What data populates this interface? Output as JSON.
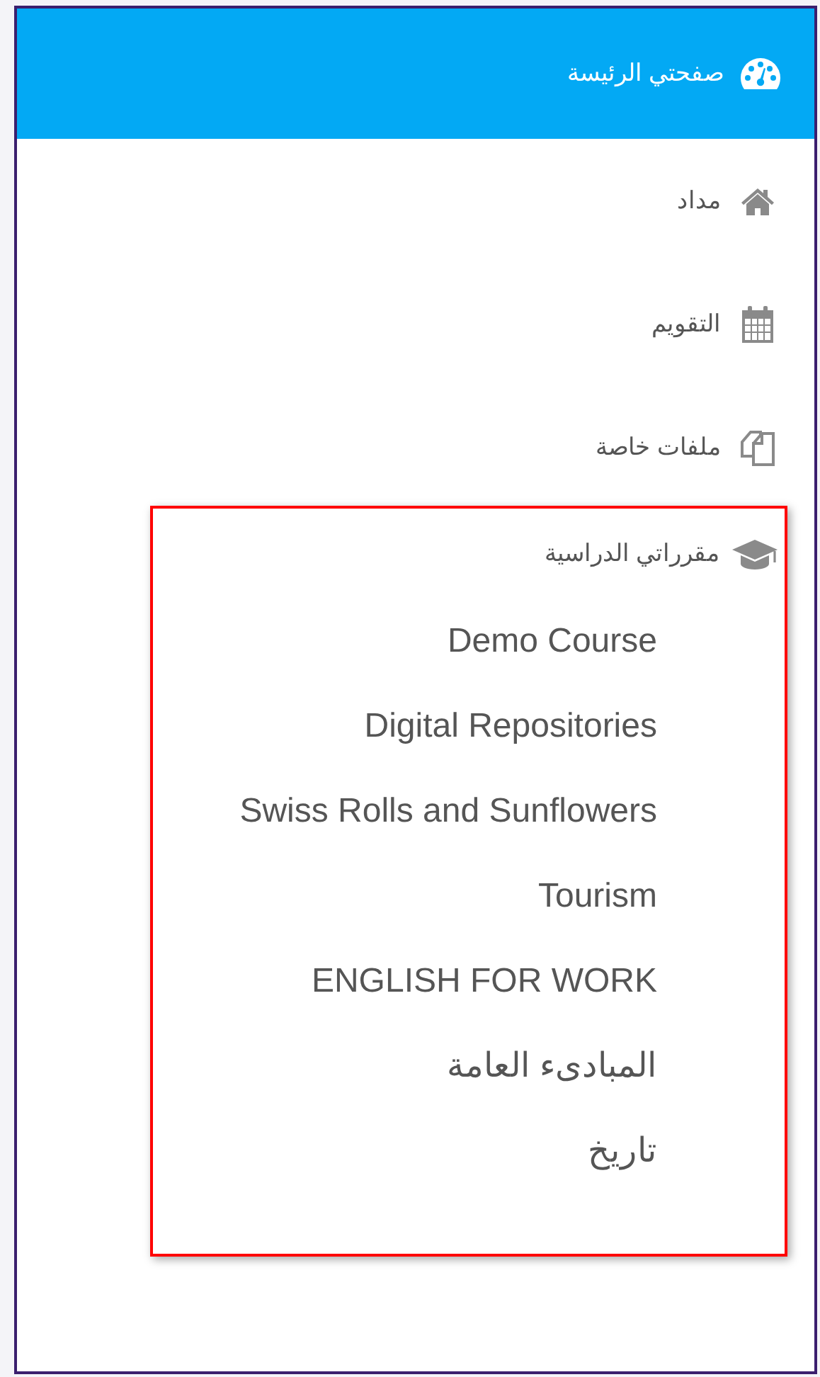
{
  "nav": [
    {
      "label": "صفحتي الرئيسة",
      "selected": true
    },
    {
      "label": "مداد",
      "selected": false
    },
    {
      "label": "التقويم",
      "selected": false
    },
    {
      "label": "ملفات خاصة",
      "selected": false
    }
  ],
  "courses_section": {
    "label": "مقرراتي الدراسية",
    "highlighted": true,
    "courses": [
      {
        "label": "Demo Course"
      },
      {
        "label": "Digital Repositories"
      },
      {
        "label": "Swiss Rolls and Sunflowers"
      },
      {
        "label": "Tourism"
      },
      {
        "label": "ENGLISH FOR WORK"
      },
      {
        "label": "المبادىء العامة"
      },
      {
        "label": "تاريخ"
      }
    ]
  }
}
